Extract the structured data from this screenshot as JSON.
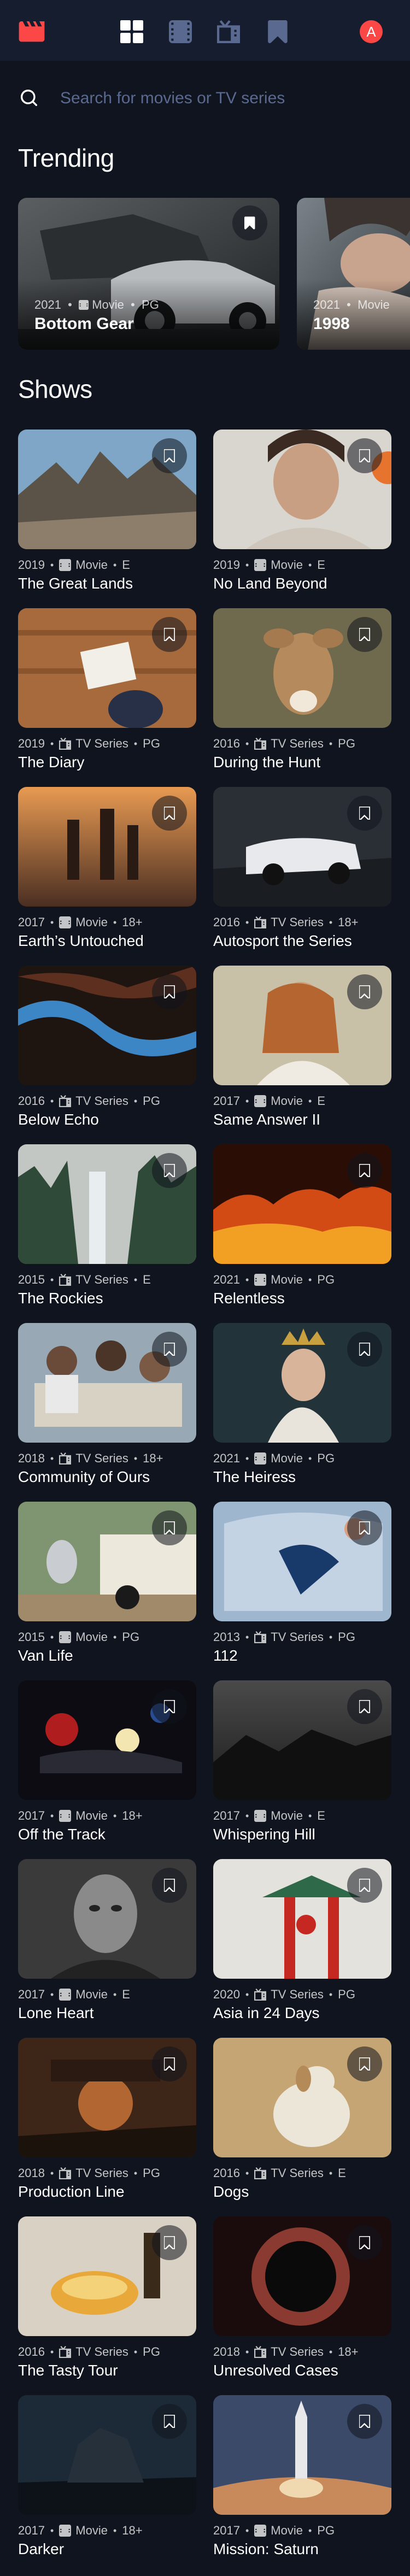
{
  "colors": {
    "background": "#10141e",
    "nav_background": "#161d2f",
    "accent": "#fc4747",
    "muted": "#5a698f"
  },
  "nav": {
    "logo_icon": "clapperboard-icon",
    "items": [
      {
        "icon": "home-grid-icon",
        "active": true
      },
      {
        "icon": "movies-film-icon",
        "active": false
      },
      {
        "icon": "tv-series-icon",
        "active": false
      },
      {
        "icon": "bookmark-nav-icon",
        "active": false
      }
    ],
    "avatar_letter": "A"
  },
  "search": {
    "placeholder": "Search for movies or TV series",
    "value": ""
  },
  "trending": {
    "heading": "Trending",
    "items": [
      {
        "year": "2021",
        "category": "Movie",
        "rating": "PG",
        "title": "Bottom Gear"
      },
      {
        "year": "2021",
        "category": "Movie",
        "rating": "",
        "title": "1998"
      }
    ]
  },
  "shows": {
    "heading": "Shows",
    "items": [
      {
        "year": "2019",
        "category": "Movie",
        "rating": "E",
        "title": "The Great Lands"
      },
      {
        "year": "2019",
        "category": "Movie",
        "rating": "E",
        "title": "No Land Beyond"
      },
      {
        "year": "2019",
        "category": "TV Series",
        "rating": "PG",
        "title": "The Diary"
      },
      {
        "year": "2016",
        "category": "TV Series",
        "rating": "PG",
        "title": "During the Hunt"
      },
      {
        "year": "2017",
        "category": "Movie",
        "rating": "18+",
        "title": "Earth’s Untouched"
      },
      {
        "year": "2016",
        "category": "TV Series",
        "rating": "18+",
        "title": "Autosport the Series"
      },
      {
        "year": "2016",
        "category": "TV Series",
        "rating": "PG",
        "title": "Below Echo"
      },
      {
        "year": "2017",
        "category": "Movie",
        "rating": "E",
        "title": "Same Answer II"
      },
      {
        "year": "2015",
        "category": "TV Series",
        "rating": "E",
        "title": "The Rockies"
      },
      {
        "year": "2021",
        "category": "Movie",
        "rating": "PG",
        "title": "Relentless"
      },
      {
        "year": "2018",
        "category": "TV Series",
        "rating": "18+",
        "title": "Community of Ours"
      },
      {
        "year": "2021",
        "category": "Movie",
        "rating": "PG",
        "title": "The Heiress"
      },
      {
        "year": "2015",
        "category": "Movie",
        "rating": "PG",
        "title": "Van Life"
      },
      {
        "year": "2013",
        "category": "TV Series",
        "rating": "PG",
        "title": "112"
      },
      {
        "year": "2017",
        "category": "Movie",
        "rating": "18+",
        "title": "Off the Track"
      },
      {
        "year": "2017",
        "category": "Movie",
        "rating": "E",
        "title": "Whispering Hill"
      },
      {
        "year": "2017",
        "category": "Movie",
        "rating": "E",
        "title": "Lone Heart"
      },
      {
        "year": "2020",
        "category": "TV Series",
        "rating": "PG",
        "title": "Asia in 24 Days"
      },
      {
        "year": "2018",
        "category": "TV Series",
        "rating": "PG",
        "title": "Production Line"
      },
      {
        "year": "2016",
        "category": "TV Series",
        "rating": "E",
        "title": "Dogs"
      },
      {
        "year": "2016",
        "category": "TV Series",
        "rating": "PG",
        "title": "The Tasty Tour"
      },
      {
        "year": "2018",
        "category": "TV Series",
        "rating": "18+",
        "title": "Unresolved Cases"
      },
      {
        "year": "2017",
        "category": "Movie",
        "rating": "18+",
        "title": "Darker"
      },
      {
        "year": "2017",
        "category": "Movie",
        "rating": "PG",
        "title": "Mission: Saturn"
      }
    ]
  }
}
